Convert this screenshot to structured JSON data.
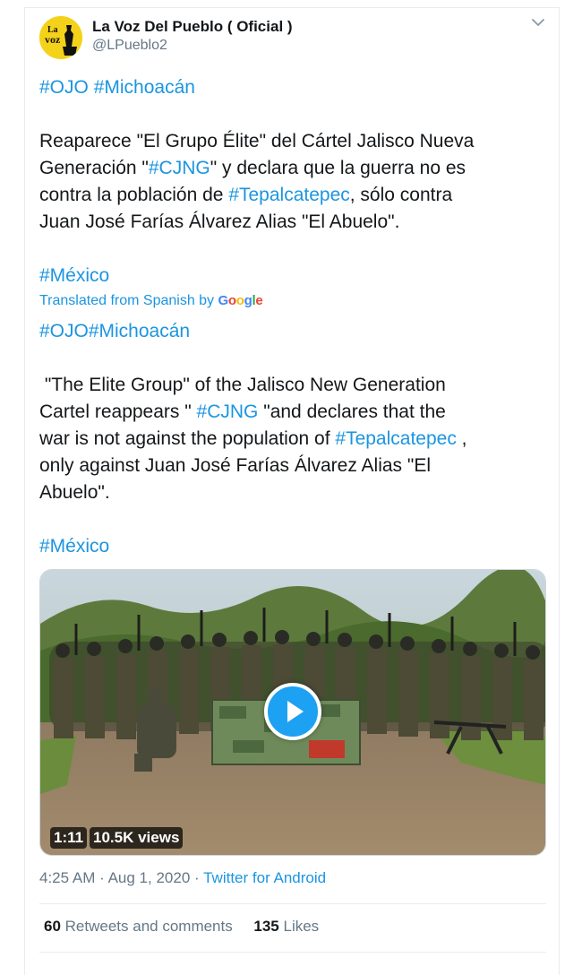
{
  "tweet": {
    "author_name": "La Voz Del Pueblo ( Oficial )",
    "author_handle": "@LPueblo2",
    "avatar_text": "La voz",
    "original": {
      "tags_line": [
        "#OJO",
        "#Michoacán"
      ],
      "p1_a": "Reaparece \"El Grupo Élite\" del Cártel Jalisco Nueva",
      "p1_b_pre": "Generación \"",
      "p1_b_tag": "#CJNG",
      "p1_b_post": "\" y declara que la guerra no es",
      "p1_c_pre": "contra la población de ",
      "p1_c_tag": "#Tepalcatepec",
      "p1_c_post": ", sólo contra",
      "p1_d": "Juan José Farías Álvarez Alias \"El Abuelo\".",
      "final_tag": "#México"
    },
    "translation_label": "Translated from Spanish by",
    "translation_provider": "Google",
    "translated": {
      "tags_line": "#OJO#Michoacán",
      "l1": " \"The Elite Group\" of the Jalisco New Generation",
      "l2_pre": "Cartel reappears \" ",
      "l2_tag": "#CJNG",
      "l2_post": " \"and declares that the",
      "l3_pre": "war is not against the population of ",
      "l3_tag": "#Tepalcatepec",
      "l3_post": " ,",
      "l4": "only against Juan José Farías Álvarez Alias \"El",
      "l5": "Abuelo\".",
      "final_tag": "#México"
    },
    "video": {
      "duration": "1:11",
      "views": "10.5K views"
    },
    "time": "4:25 AM",
    "date": "Aug 1, 2020",
    "source": "Twitter for Android",
    "retweets_count": "60",
    "retweets_label": "Retweets and comments",
    "likes_count": "135",
    "likes_label": "Likes",
    "colors": {
      "link": "#1b95e0",
      "text": "#14171a",
      "muted": "#657786",
      "play": "#1da1f2"
    }
  }
}
